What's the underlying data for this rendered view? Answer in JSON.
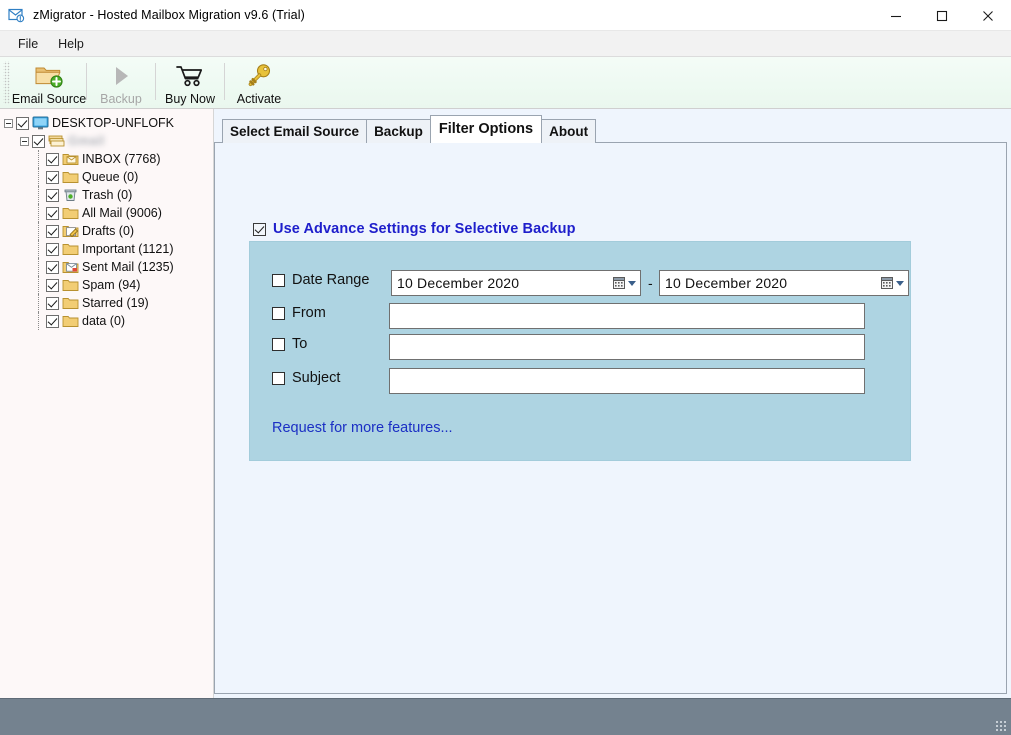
{
  "window": {
    "title": "zMigrator - Hosted Mailbox Migration v9.6 (Trial)",
    "icon": "mail-badge-icon",
    "minimize_label": "–",
    "maximize_label": "□",
    "close_label": "✕"
  },
  "menubar": {
    "items": [
      {
        "label": "File",
        "name": "menu-file"
      },
      {
        "label": "Help",
        "name": "menu-help"
      }
    ]
  },
  "toolbar": {
    "buttons": [
      {
        "label": "Email Source",
        "icon": "folder-add-icon",
        "disabled": false
      },
      {
        "label": "Backup",
        "icon": "play-arrow-icon",
        "disabled": true
      },
      {
        "label": "Buy Now",
        "icon": "shopping-cart-icon",
        "disabled": false
      },
      {
        "label": "Activate",
        "icon": "key-icon",
        "disabled": false
      }
    ]
  },
  "tree": {
    "root": {
      "label": "DESKTOP-UNFLOFK",
      "icon": "monitor-icon",
      "checked": true,
      "expanded": true
    },
    "account": {
      "label": "Gmail",
      "icon": "mail-stack-icon",
      "checked": true,
      "expanded": true,
      "redacted": true
    },
    "folders": [
      {
        "label": "INBOX (7768)",
        "icon": "inbox-folder-icon",
        "checked": true
      },
      {
        "label": "Queue (0)",
        "icon": "folder-icon",
        "checked": true
      },
      {
        "label": "Trash (0)",
        "icon": "trash-icon",
        "checked": true
      },
      {
        "label": "All Mail (9006)",
        "icon": "folder-icon",
        "checked": true
      },
      {
        "label": "Drafts (0)",
        "icon": "drafts-folder-icon",
        "checked": true
      },
      {
        "label": "Important (1121)",
        "icon": "folder-icon",
        "checked": true
      },
      {
        "label": "Sent Mail (1235)",
        "icon": "sent-folder-icon",
        "checked": true
      },
      {
        "label": "Spam (94)",
        "icon": "folder-icon",
        "checked": true
      },
      {
        "label": "Starred (19)",
        "icon": "folder-icon",
        "checked": true
      },
      {
        "label": "data (0)",
        "icon": "folder-icon",
        "checked": true
      }
    ]
  },
  "tabs": [
    {
      "label": "Select Email Source",
      "active": false
    },
    {
      "label": "Backup",
      "active": false
    },
    {
      "label": "Filter Options",
      "active": true
    },
    {
      "label": "About",
      "active": false
    }
  ],
  "filter": {
    "advance_settings": {
      "label": "Use Advance Settings for Selective Backup",
      "checked": true
    },
    "rows": [
      {
        "label": "Date Range",
        "checked": false
      },
      {
        "label": "From",
        "checked": false,
        "value": "",
        "placeholder": ""
      },
      {
        "label": "To",
        "checked": false,
        "value": "",
        "placeholder": ""
      },
      {
        "label": "Subject",
        "checked": false,
        "value": "",
        "placeholder": ""
      }
    ],
    "date_from": "10  December  2020",
    "date_to": "10  December  2020",
    "date_separator": "-",
    "request_link": "Request for more features..."
  },
  "colors": {
    "accent_blue": "#1e1ecb",
    "panel_blue": "#aed4e2",
    "page_blue": "#eff5fd",
    "tree_bg": "#fdf8f8",
    "statusbar": "#74828f",
    "toolbar": "#eefaf2"
  }
}
